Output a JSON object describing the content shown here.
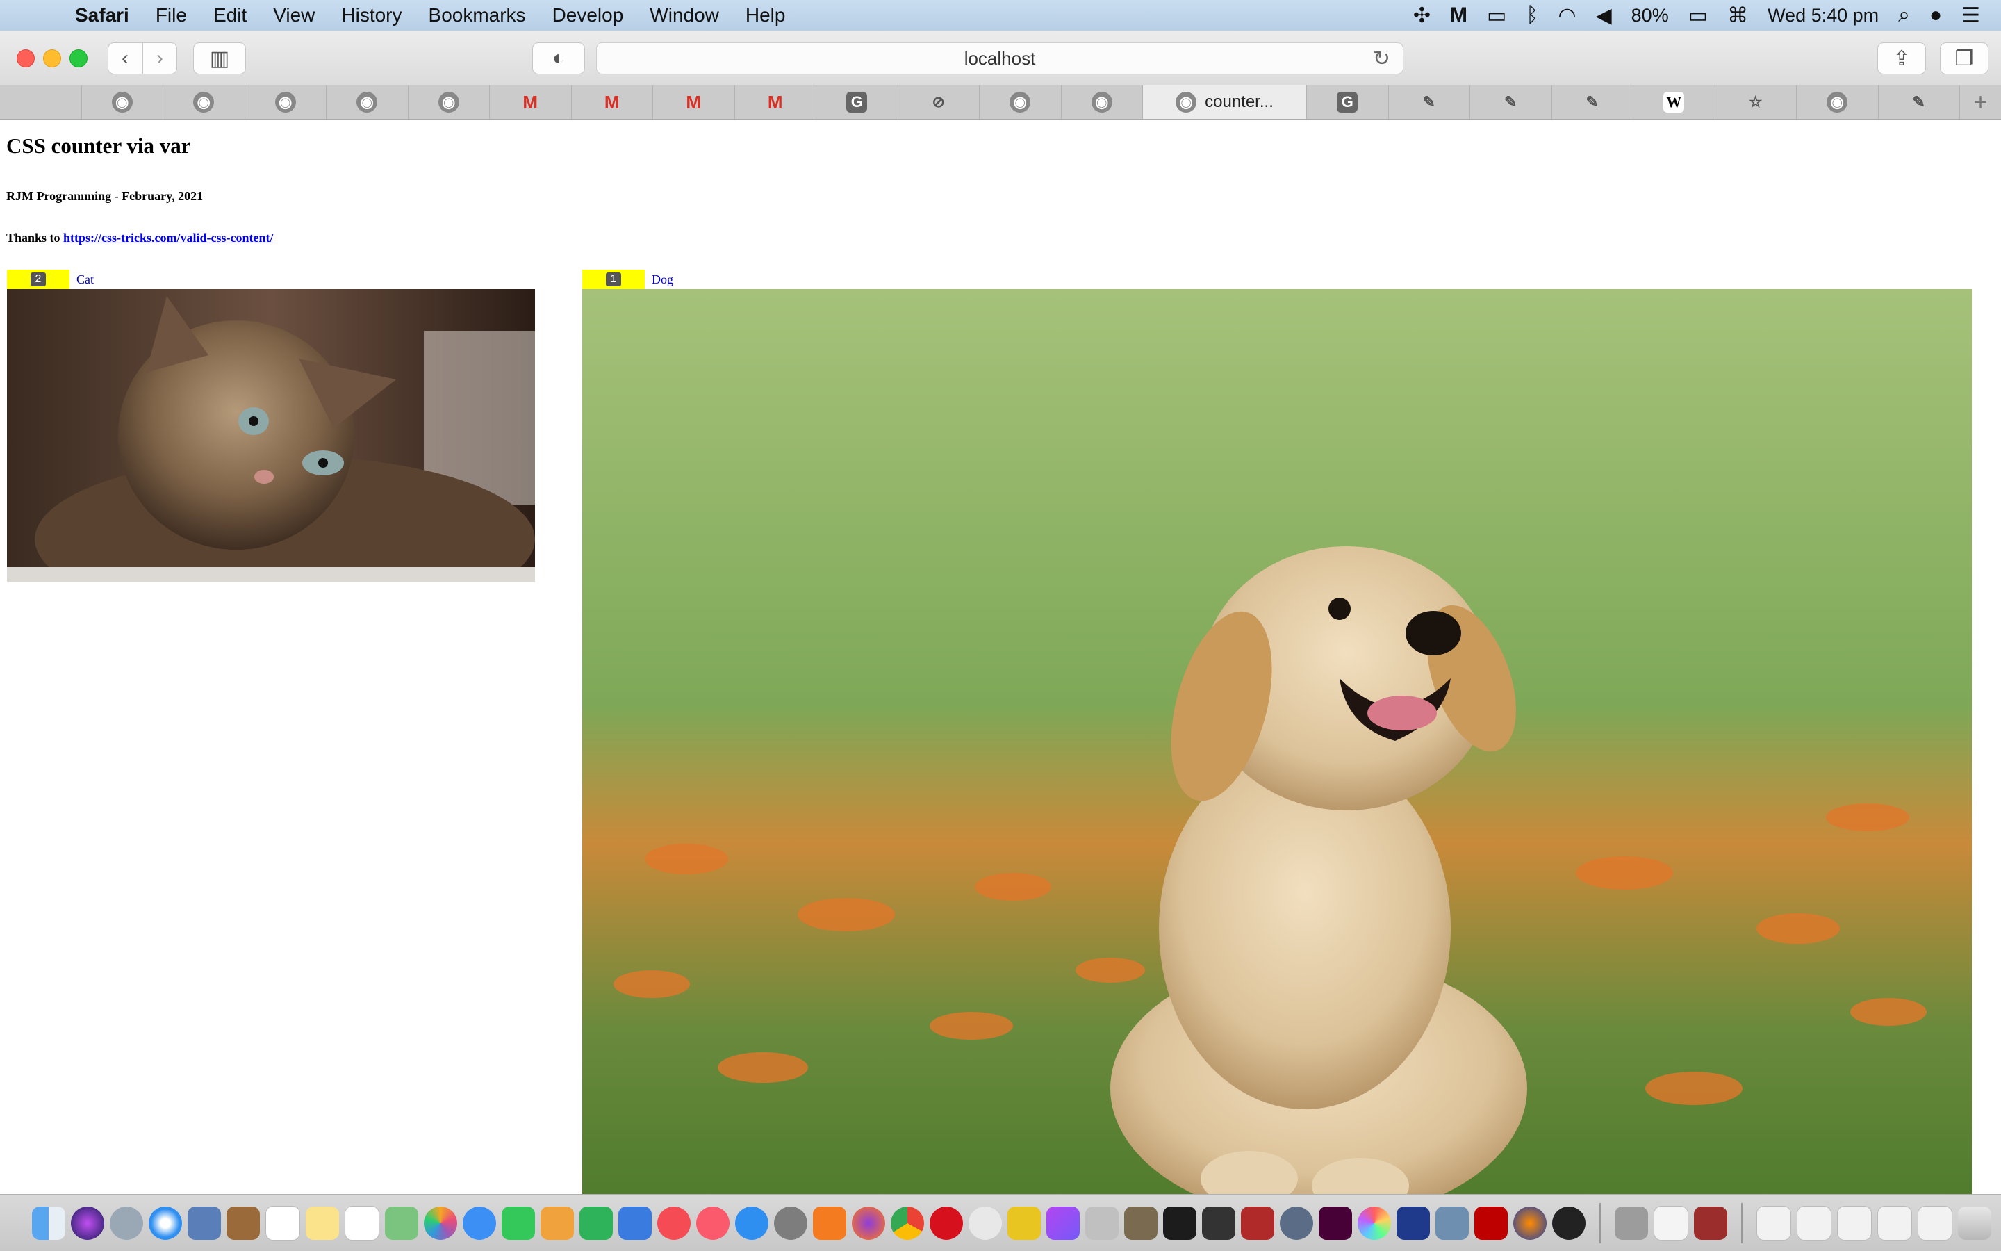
{
  "menubar": {
    "apple_icon": "apple-logo-icon",
    "app_name": "Safari",
    "items": [
      "File",
      "Edit",
      "View",
      "History",
      "Bookmarks",
      "Develop",
      "Window",
      "Help"
    ],
    "battery": "80%",
    "clock": "Wed 5:40 pm"
  },
  "toolbar": {
    "url": "localhost"
  },
  "tabs": {
    "active_title": "counter...",
    "items": [
      {
        "icon": "apple-icon",
        "glyph": ""
      },
      {
        "icon": "elephant-icon",
        "glyph": "◉"
      },
      {
        "icon": "elephant-icon",
        "glyph": "◉"
      },
      {
        "icon": "elephant-icon",
        "glyph": "◉"
      },
      {
        "icon": "elephant-icon",
        "glyph": "◉"
      },
      {
        "icon": "elephant-icon",
        "glyph": "◉"
      },
      {
        "icon": "gmail-icon",
        "glyph": "M"
      },
      {
        "icon": "gmail-icon",
        "glyph": "M"
      },
      {
        "icon": "gmail-icon",
        "glyph": "M"
      },
      {
        "icon": "gmail-icon",
        "glyph": "M"
      },
      {
        "icon": "google-icon",
        "glyph": "G"
      },
      {
        "icon": "compass-icon",
        "glyph": "⊘"
      },
      {
        "icon": "elephant-icon",
        "glyph": "◉"
      },
      {
        "icon": "elephant-icon",
        "glyph": "◉"
      }
    ],
    "items_after": [
      {
        "icon": "google-icon",
        "glyph": "G"
      },
      {
        "icon": "drawing-icon",
        "glyph": "✎"
      },
      {
        "icon": "drawing-icon",
        "glyph": "✎"
      },
      {
        "icon": "drawing-icon",
        "glyph": "✎"
      },
      {
        "icon": "wikipedia-icon",
        "glyph": "W"
      },
      {
        "icon": "star-icon",
        "glyph": "☆"
      },
      {
        "icon": "elephant-icon",
        "glyph": "◉"
      },
      {
        "icon": "drawing-icon",
        "glyph": "✎"
      }
    ]
  },
  "page": {
    "title": "CSS counter via var",
    "byline": "RJM Programming - February, 2021",
    "thanks_prefix": "Thanks to ",
    "thanks_link": "https://css-tricks.com/valid-css-content/",
    "figures": [
      {
        "counter": "2",
        "label": "Cat"
      },
      {
        "counter": "1",
        "label": "Dog"
      }
    ]
  },
  "colors": {
    "badge_bg": "#ffff00",
    "link": "#0000ee"
  }
}
